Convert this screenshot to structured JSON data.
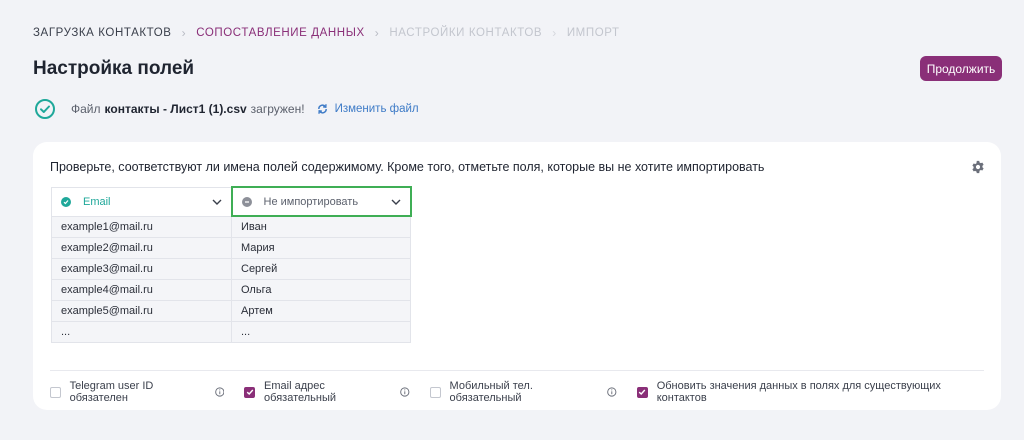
{
  "breadcrumb": {
    "steps": [
      "ЗАГРУЗКА КОНТАКТОВ",
      "СОПОСТАВЛЕНИЕ ДАННЫХ",
      "НАСТРОЙКИ КОНТАКТОВ",
      "ИМПОРТ"
    ],
    "active_index": 1
  },
  "header": {
    "title": "Настройка полей",
    "continue_label": "Продолжить"
  },
  "file": {
    "prefix": "Файл",
    "name": "контакты - Лист1 (1).csv",
    "suffix": "загружен!",
    "change_label": "Изменить файл"
  },
  "card": {
    "description": "Проверьте, соответствуют ли имена полей содержимому. Кроме того, отметьте поля, которые вы не хотите импортировать"
  },
  "columns": [
    {
      "label": "Email",
      "status": "mapped",
      "status_color": "#1fa89a",
      "rows": [
        "example1@mail.ru",
        "example2@mail.ru",
        "example3@mail.ru",
        "example4@mail.ru",
        "example5@mail.ru",
        "..."
      ]
    },
    {
      "label": "Не импортировать",
      "status": "skip",
      "status_color": "#8d9099",
      "selected": true,
      "rows": [
        "Иван",
        "Мария",
        "Сергей",
        "Ольга",
        "Артем",
        "..."
      ]
    }
  ],
  "options": [
    {
      "label": "Telegram user ID обязателен",
      "checked": false,
      "info": true
    },
    {
      "label": "Email адрес обязательный",
      "checked": true,
      "info": true
    },
    {
      "label": "Мобильный тел. обязательный",
      "checked": false,
      "info": true
    },
    {
      "label": "Обновить значения данных в полях для существующих контактов",
      "checked": true,
      "info": false
    }
  ],
  "colors": {
    "accent": "#8a2f78",
    "mapped": "#1fa89a",
    "selected_border": "#3fae55",
    "link": "#3e7bc7"
  }
}
